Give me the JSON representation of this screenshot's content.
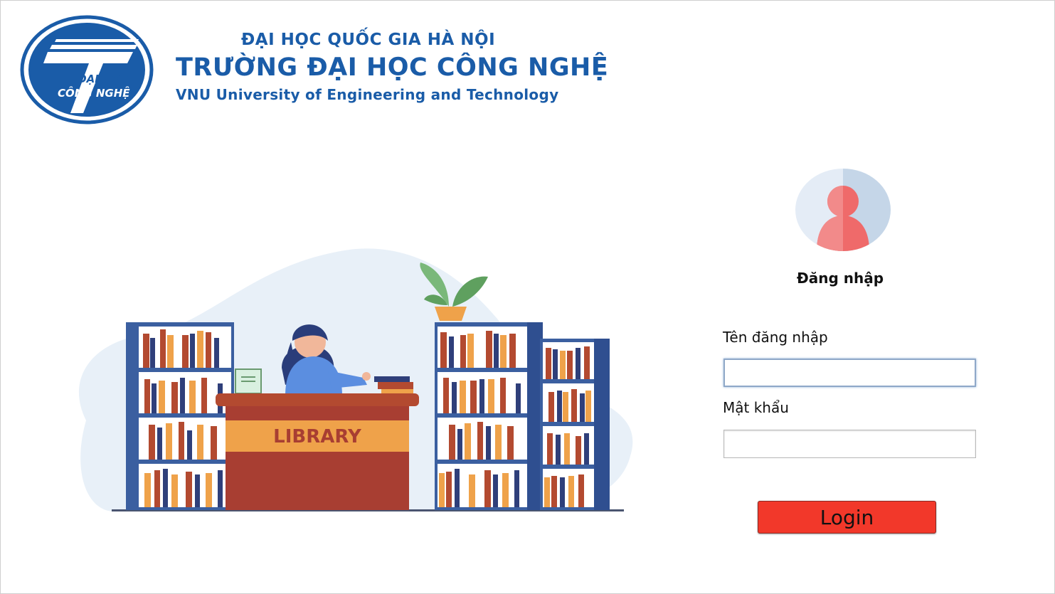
{
  "header": {
    "logo_text_line1": "ĐẠI HỌC",
    "logo_text_line2": "CÔNG NGHỆ",
    "line1": "ĐẠI HỌC QUỐC GIA HÀ NỘI",
    "line2": "TRƯỜNG ĐẠI HỌC CÔNG NGHỆ",
    "line3": "VNU University of Engineering and Technology"
  },
  "illustration": {
    "desk_sign": "LIBRARY"
  },
  "login": {
    "title": "Đăng nhập",
    "username_label": "Tên đăng nhập",
    "username_value": "",
    "password_label": "Mật khẩu",
    "password_value": "",
    "submit_label": "Login"
  },
  "colors": {
    "brand_blue": "#1a5ca8",
    "login_button": "#f2382a"
  }
}
